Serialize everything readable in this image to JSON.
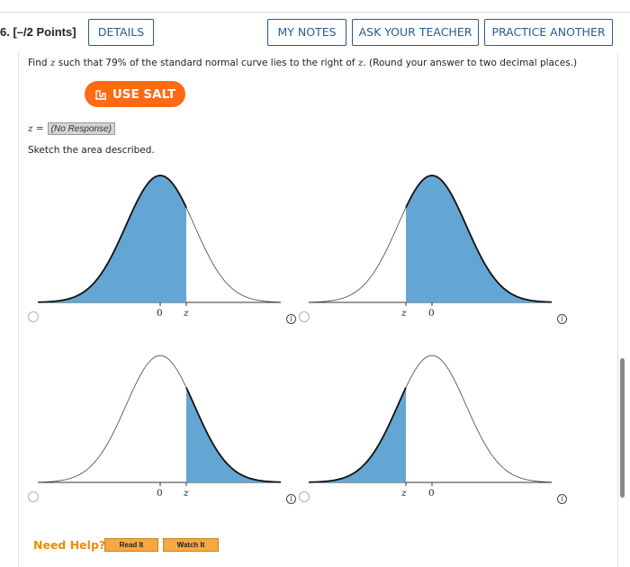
{
  "header": {
    "points": "6.  [–/2 Points]",
    "details_label": "DETAILS",
    "my_notes_label": "MY NOTES",
    "ask_teacher_label": "ASK YOUR TEACHER",
    "practice_another_label": "PRACTICE ANOTHER"
  },
  "question": {
    "text_before": "Find ",
    "var": "z",
    "text_mid": " such that 79% of the standard normal curve lies to the right of ",
    "var2": "z",
    "text_after": ". (Round your answer to two decimal places.)"
  },
  "salt": {
    "label": "USE SALT",
    "icon": "salt-icon"
  },
  "answer": {
    "label": "z =",
    "value": "(No Response)"
  },
  "sketch_prompt": "Sketch the area described.",
  "graph_options": [
    {
      "shade": "left",
      "labels": [
        "0",
        "z"
      ],
      "z_side": "right"
    },
    {
      "shade": "right",
      "labels": [
        "z",
        "0"
      ],
      "z_side": "left"
    },
    {
      "shade": "right",
      "labels": [
        "0",
        "z"
      ],
      "z_side": "right"
    },
    {
      "shade": "left",
      "labels": [
        "z",
        "0"
      ],
      "z_side": "left"
    }
  ],
  "colors": {
    "shade": "#63a6d4",
    "accent": "#ff6a13",
    "button_border": "#2a5b8f"
  },
  "help": {
    "label": "Need Help?",
    "read_label": "Read It",
    "watch_label": "Watch It"
  }
}
